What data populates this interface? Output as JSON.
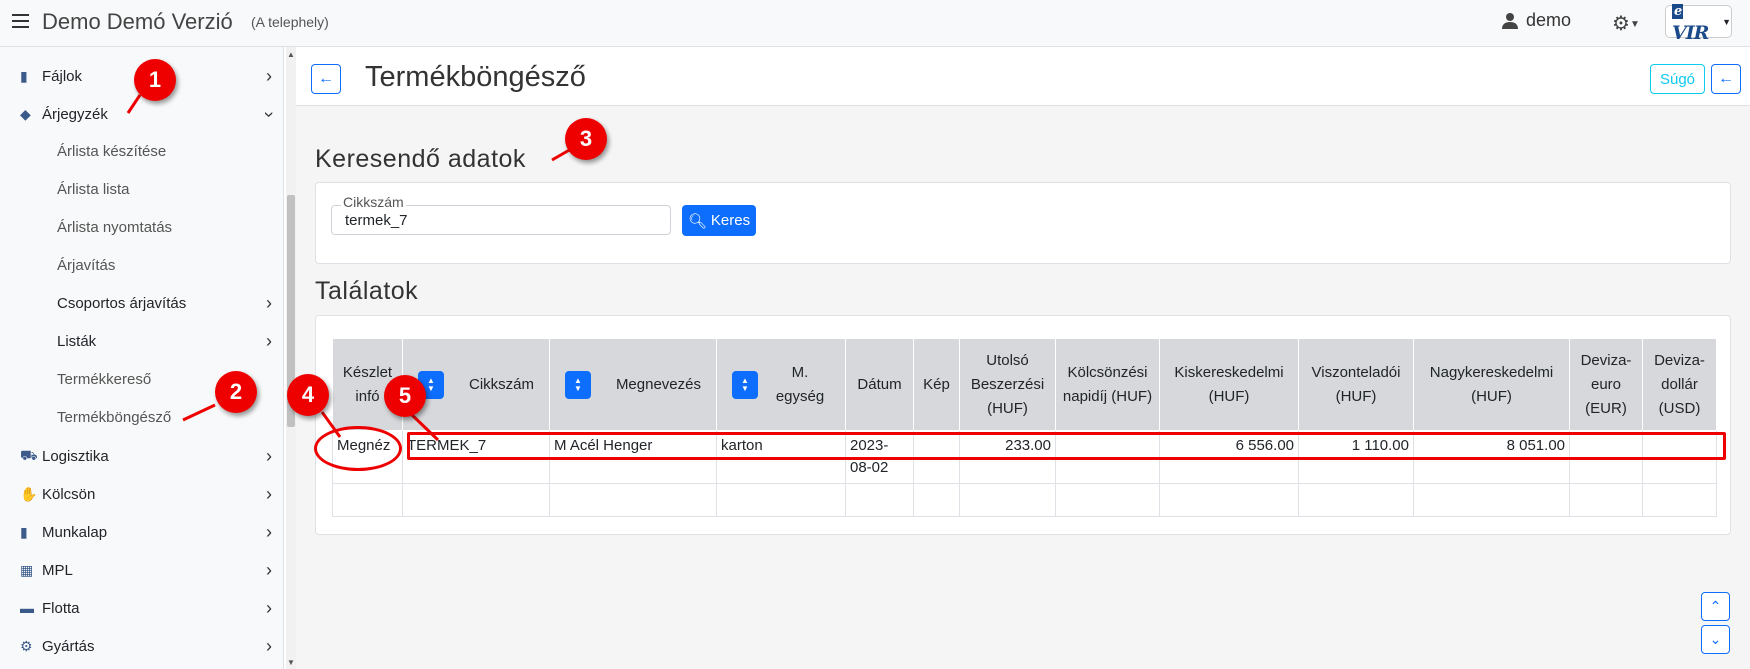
{
  "app": {
    "title": "Demo Demó Verzió",
    "subtitle": "(A telephely)",
    "user": "demo",
    "logo_text": "VIR",
    "logo_prefix": "e"
  },
  "sidebar": {
    "items": [
      {
        "label": "Fájlok",
        "icon": "file-icon"
      },
      {
        "label": "Árjegyzék",
        "icon": "tags-icon"
      },
      {
        "label": "Logisztika",
        "icon": "dolly-icon"
      },
      {
        "label": "Kölcsön",
        "icon": "hand-icon"
      },
      {
        "label": "Munkalap",
        "icon": "document-icon"
      },
      {
        "label": "MPL",
        "icon": "pallet-icon"
      },
      {
        "label": "Flotta",
        "icon": "car-icon"
      },
      {
        "label": "Gyártás",
        "icon": "cogs-icon"
      }
    ],
    "subitems": [
      "Árlista készítése",
      "Árlista lista",
      "Árlista nyomtatás",
      "Árjavítás",
      "Csoportos árjavítás",
      "Listák",
      "Termékkereső",
      "Termékböngésző"
    ]
  },
  "page": {
    "title": "Termékböngésző",
    "help_label": "Súgó"
  },
  "search": {
    "section_title": "Keresendő adatok",
    "field_label": "Cikkszám",
    "field_value": "termek_7",
    "button_label": "Keres"
  },
  "results": {
    "section_title": "Találatok",
    "headers": [
      "Készlet infó",
      "Cikkszám",
      "Megnevezés",
      "M. egység",
      "Dátum",
      "Kép",
      "Utolsó Beszerzési (HUF)",
      "Kölcsönzési napidíj (HUF)",
      "Kiskereskedelmi (HUF)",
      "Viszonteladói (HUF)",
      "Nagykereskedelmi (HUF)",
      "Deviza-euro (EUR)",
      "Deviza-dollár (USD)"
    ],
    "rows": [
      {
        "info": "Megnéz",
        "sku": "TERMEK_7",
        "name": "M Acél Henger",
        "unit": "karton",
        "date": "2023-08-02",
        "image": "",
        "last_purchase": "233.00",
        "rental": "",
        "retail": "6 556.00",
        "reseller": "1 110.00",
        "wholesale": "8 051.00",
        "eur": "",
        "usd": ""
      }
    ]
  },
  "annotations": {
    "b1": "1",
    "b2": "2",
    "b3": "3",
    "b4": "4",
    "b5": "5"
  },
  "colors": {
    "accent": "#0d6efd",
    "annotation": "#e00000",
    "info": "#0dcaf0"
  }
}
